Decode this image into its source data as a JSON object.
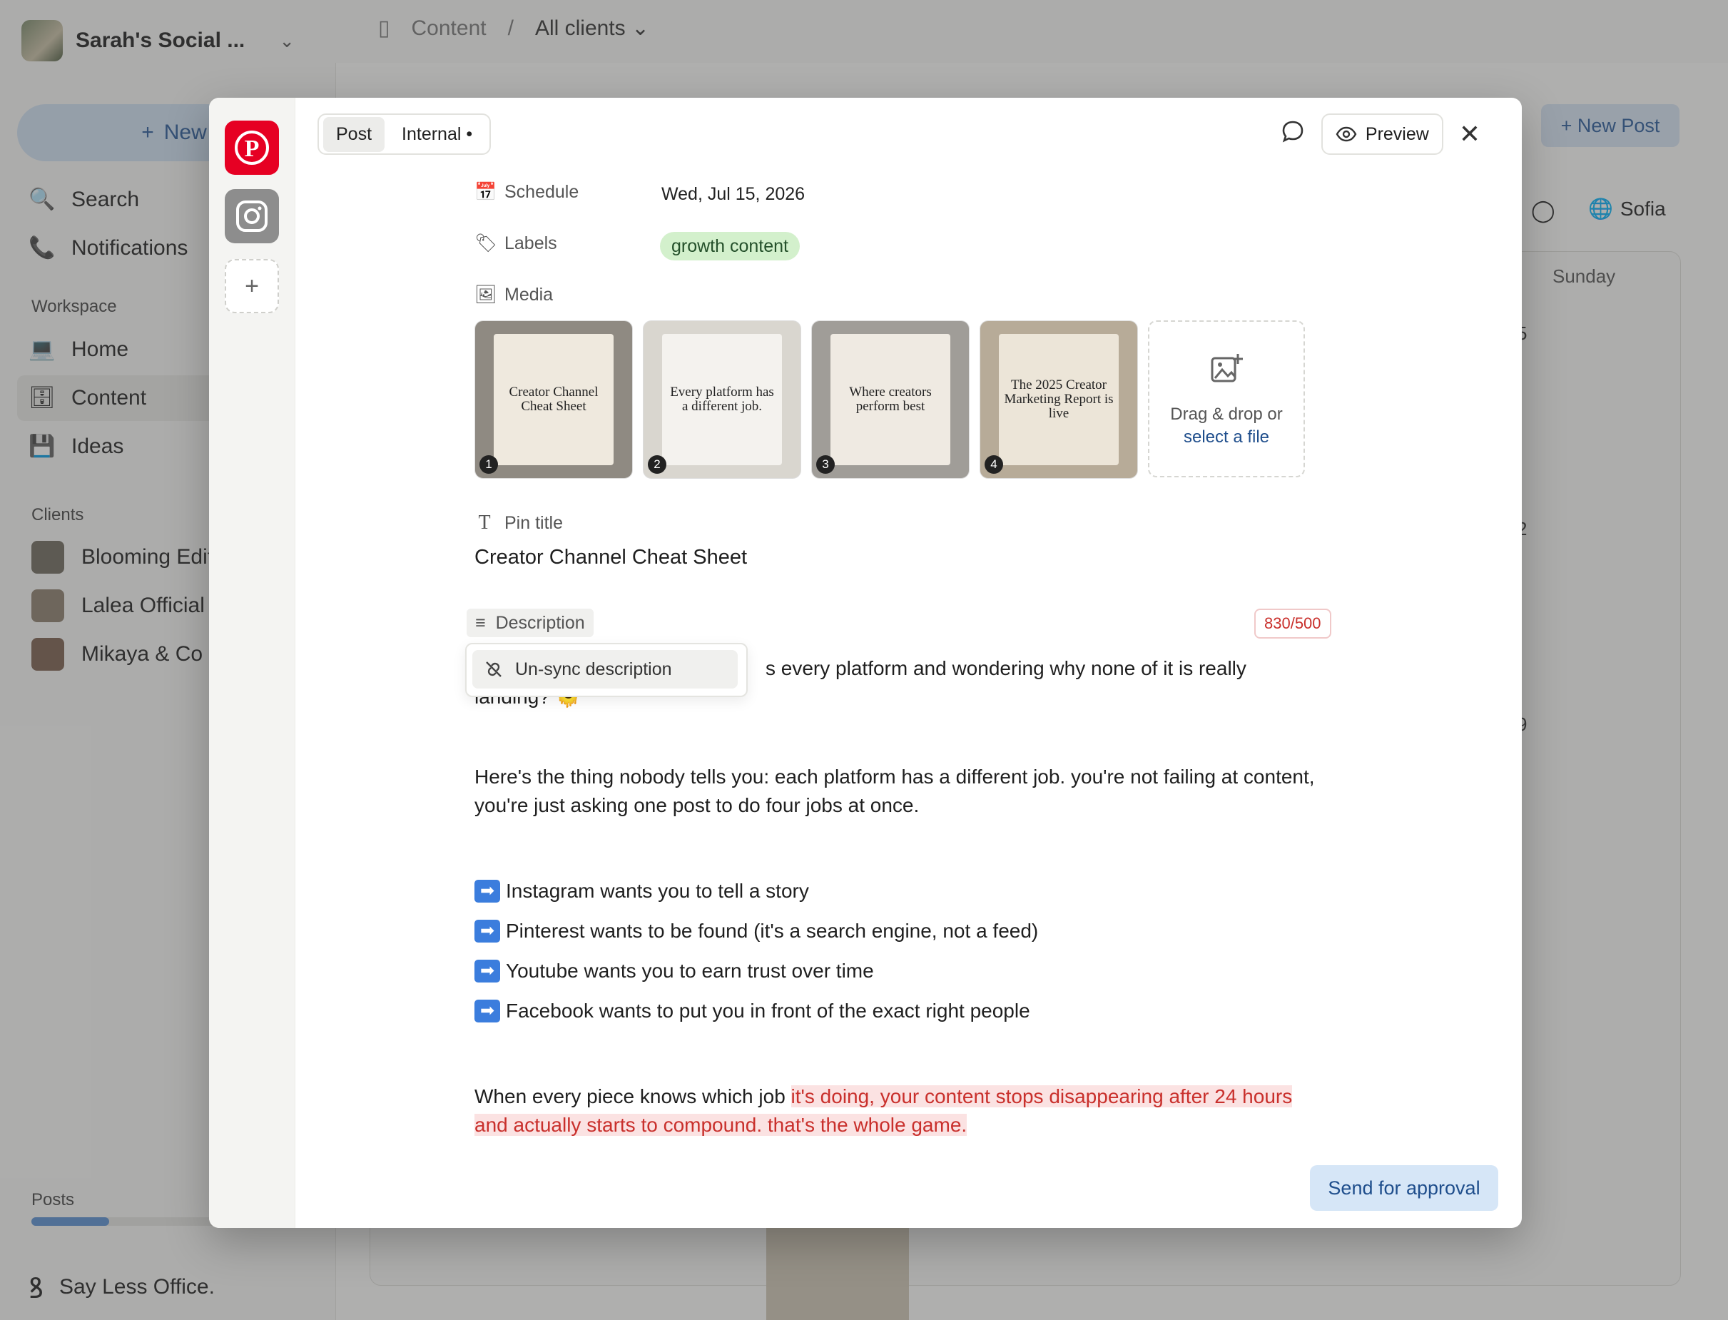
{
  "sidebar": {
    "workspace_name": "Sarah's Social ...",
    "new_label": "New",
    "nav": [
      {
        "label": "Search",
        "icon": "search-icon"
      },
      {
        "label": "Notifications",
        "icon": "phone-icon"
      }
    ],
    "workspace_heading": "Workspace",
    "workspace_items": [
      {
        "label": "Home",
        "icon": "laptop-icon"
      },
      {
        "label": "Content",
        "icon": "filing-cabinet-icon"
      },
      {
        "label": "Ideas",
        "icon": "floppy-disk-icon"
      }
    ],
    "clients_heading": "Clients",
    "clients": [
      {
        "label": "Blooming Edit"
      },
      {
        "label": "Lalea Official"
      },
      {
        "label": "Mikaya & Co"
      }
    ],
    "posts_label": "Posts",
    "posts_progress": 0.42,
    "brand": "Say Less Office."
  },
  "header": {
    "breadcrumb_root": "Content",
    "breadcrumb_sep": "/",
    "breadcrumb_current": "All clients"
  },
  "background": {
    "new_post_label": "+ New Post",
    "user_label": "Sofia",
    "day_header": "Sunday",
    "day_numbers": [
      "5",
      "2",
      "9"
    ]
  },
  "modal": {
    "tabs": [
      {
        "label": "Post",
        "active": true
      },
      {
        "label": "Internal •",
        "active": false
      }
    ],
    "preview_label": "Preview",
    "schedule": {
      "label": "Schedule",
      "value": "Wed, Jul 15, 2026"
    },
    "labels": {
      "label": "Labels",
      "chip": "growth content"
    },
    "media": {
      "label": "Media",
      "items": [
        {
          "num": "1",
          "title": "Creator Channel Cheat Sheet"
        },
        {
          "num": "2",
          "title": "Every platform has a different job."
        },
        {
          "num": "3",
          "title": "Where creators perform best"
        },
        {
          "num": "4",
          "title": "The 2025 Creator Marketing Report is live"
        }
      ],
      "drop_text": "Drag & drop or",
      "drop_link": "select a file"
    },
    "pin_title": {
      "label": "Pin title",
      "value": "Creator Channel Cheat Sheet"
    },
    "description": {
      "label": "Description",
      "counter": "830/500",
      "line1_visible": "s every platform and wondering why none of it is really",
      "line1b": "landing? 🫠",
      "para2": "Here's the thing nobody tells you: each platform has a different job. you're not failing at content, you're just asking one post to do four jobs at once.",
      "list": [
        "Instagram wants you to tell a story",
        "Pinterest wants to be found (it's a search engine, not a feed)",
        "Youtube wants you to earn trust over time",
        "Facebook wants to put you in front of the exact right people"
      ],
      "list_bullet": "➡",
      "para4_normal": "When every piece knows which job ",
      "para4_over": "it's doing, your content stops disappearing after 24 hours and actually starts to compound. that's the whole game."
    },
    "popover_item": "Un-sync description",
    "send_label": "Send for approval",
    "colors": {
      "pinterest": "#e60023",
      "over_limit": "#c9302c",
      "label_chip": "#d3f0cc",
      "primary_soft": "#d6e6f7"
    }
  }
}
